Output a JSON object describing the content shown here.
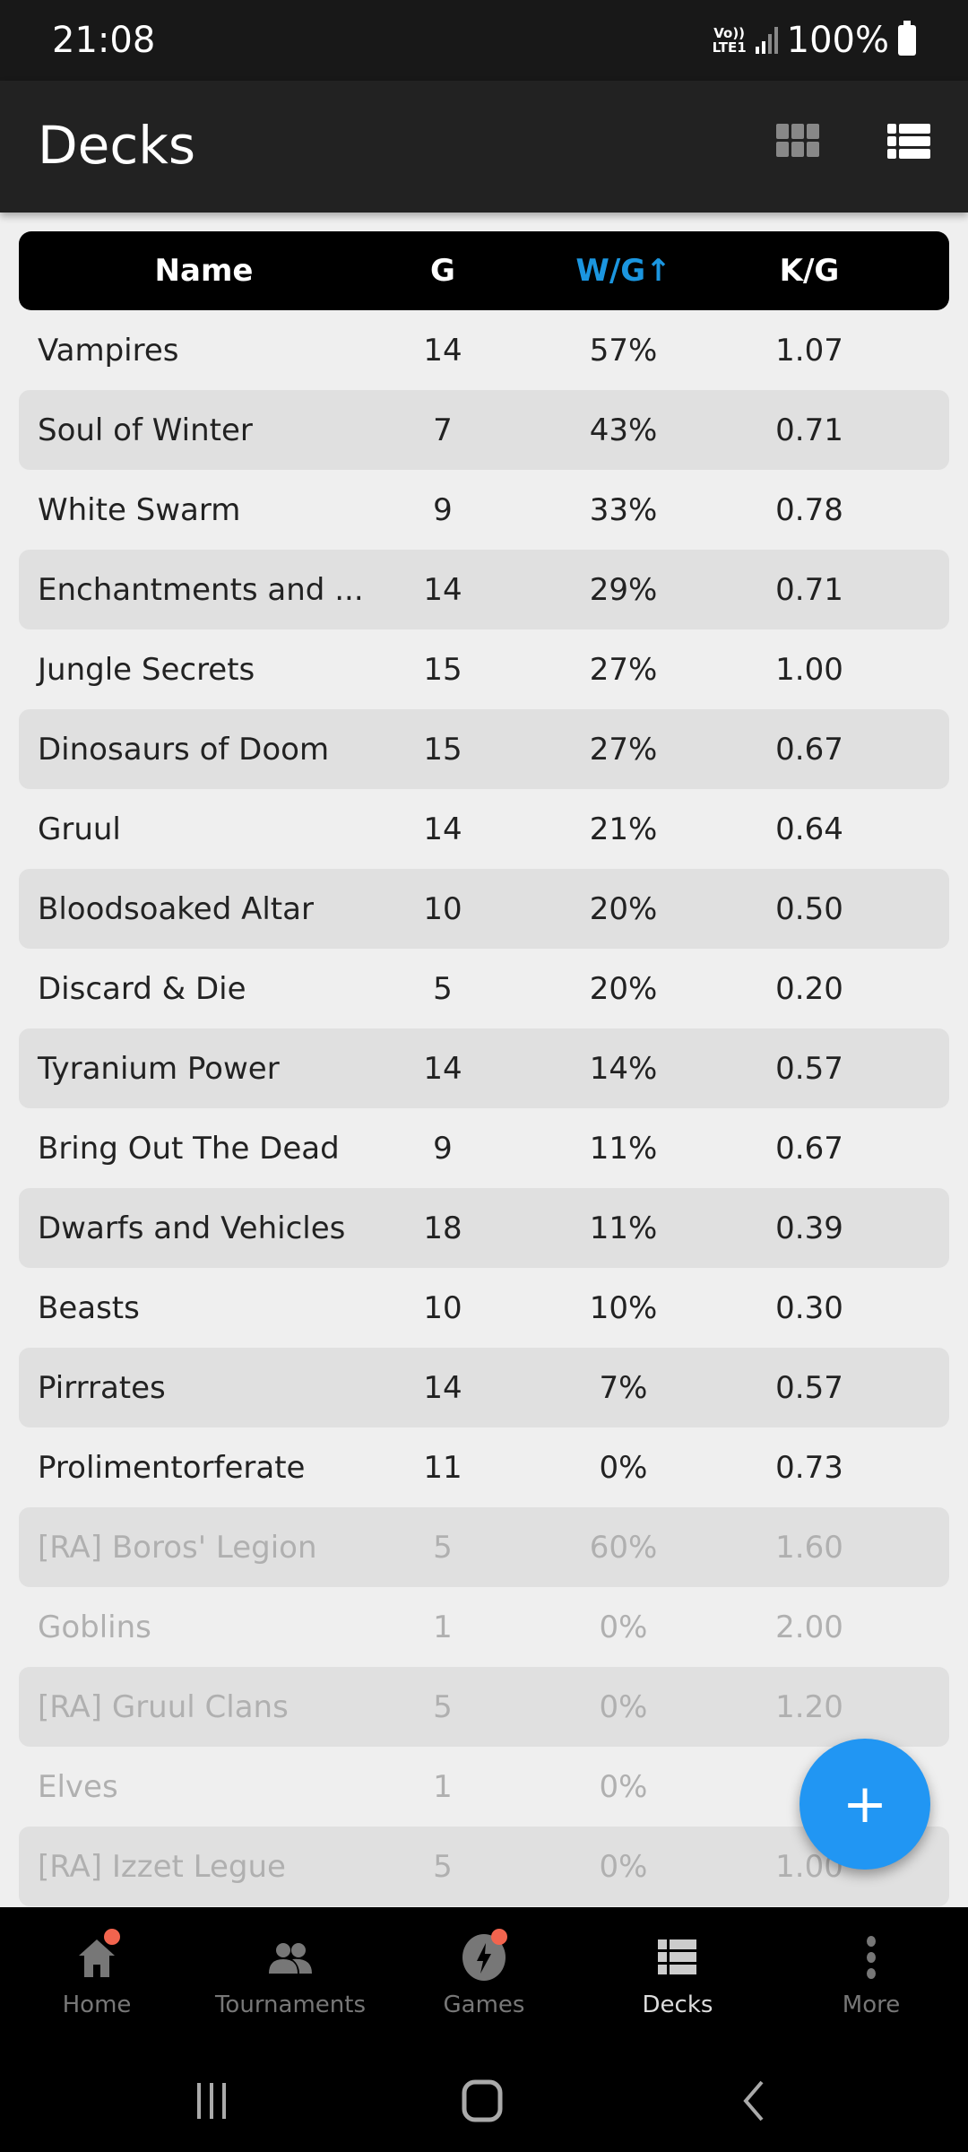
{
  "status_bar": {
    "time": "21:08",
    "network": "Vo)) LTE1",
    "battery": "100%"
  },
  "app_bar": {
    "title": "Decks",
    "grid_view_icon": "grid-icon",
    "list_view_icon": "list-icon"
  },
  "table": {
    "headers": {
      "name": "Name",
      "g": "G",
      "wg": "W/G↑",
      "kg": "K/G"
    },
    "rows": [
      {
        "name": "Vampires",
        "g": "14",
        "wg": "57%",
        "kg": "1.07"
      },
      {
        "name": "Soul of Winter",
        "g": "7",
        "wg": "43%",
        "kg": "0.71"
      },
      {
        "name": "White Swarm",
        "g": "9",
        "wg": "33%",
        "kg": "0.78"
      },
      {
        "name": "Enchantments and ...",
        "g": "14",
        "wg": "29%",
        "kg": "0.71"
      },
      {
        "name": "Jungle Secrets",
        "g": "15",
        "wg": "27%",
        "kg": "1.00"
      },
      {
        "name": "Dinosaurs of Doom",
        "g": "15",
        "wg": "27%",
        "kg": "0.67"
      },
      {
        "name": "Gruul",
        "g": "14",
        "wg": "21%",
        "kg": "0.64"
      },
      {
        "name": "Bloodsoaked Altar",
        "g": "10",
        "wg": "20%",
        "kg": "0.50"
      },
      {
        "name": "Discard & Die",
        "g": "5",
        "wg": "20%",
        "kg": "0.20"
      },
      {
        "name": "Tyranium Power",
        "g": "14",
        "wg": "14%",
        "kg": "0.57"
      },
      {
        "name": "Bring Out The Dead",
        "g": "9",
        "wg": "11%",
        "kg": "0.67"
      },
      {
        "name": "Dwarfs and Vehicles",
        "g": "18",
        "wg": "11%",
        "kg": "0.39"
      },
      {
        "name": "Beasts",
        "g": "10",
        "wg": "10%",
        "kg": "0.30"
      },
      {
        "name": "Pirrrates",
        "g": "14",
        "wg": "7%",
        "kg": "0.57"
      },
      {
        "name": "Prolimentorferate",
        "g": "11",
        "wg": "0%",
        "kg": "0.73"
      },
      {
        "name": "[RA] Boros' Legion",
        "g": "5",
        "wg": "60%",
        "kg": "1.60",
        "inactive": true
      },
      {
        "name": "Goblins",
        "g": "1",
        "wg": "0%",
        "kg": "2.00",
        "inactive": true
      },
      {
        "name": "[RA] Gruul Clans",
        "g": "5",
        "wg": "0%",
        "kg": "1.20",
        "inactive": true
      },
      {
        "name": "Elves",
        "g": "1",
        "wg": "0%",
        "kg": "",
        "inactive": true
      },
      {
        "name": "[RA] Izzet Legue",
        "g": "5",
        "wg": "0%",
        "kg": "1.00",
        "inactive": true
      }
    ]
  },
  "fab": {
    "label": "+"
  },
  "bottom_nav": [
    {
      "label": "Home",
      "icon": "home-icon",
      "badge": true
    },
    {
      "label": "Tournaments",
      "icon": "people-icon",
      "badge": false
    },
    {
      "label": "Games",
      "icon": "lightning-icon",
      "badge": true
    },
    {
      "label": "Decks",
      "icon": "decks-icon",
      "badge": false,
      "active": true
    },
    {
      "label": "More",
      "icon": "more-vert-icon",
      "badge": false
    }
  ],
  "colors": {
    "accent": "#1b96e0",
    "fab": "#2196f3",
    "badge": "#f2644e"
  }
}
